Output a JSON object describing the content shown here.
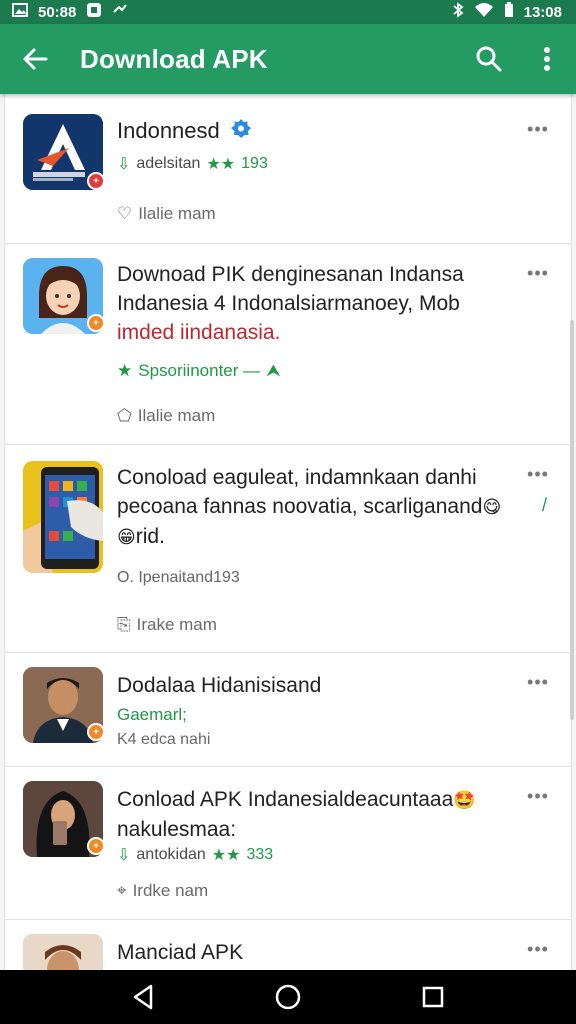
{
  "status_bar": {
    "left_text": "50:88",
    "right_time": "13:08"
  },
  "app_bar": {
    "title": "Download APK"
  },
  "items": [
    {
      "title": "Indonnesd",
      "meta_text": "adelsitan",
      "rating": "193",
      "action": "Ilalie mam"
    },
    {
      "title_line1": "Downoad PIK denginesanan Indansa",
      "title_line2": "Indanesia 4 Indonalsiarmanoey, Mob",
      "title_line3": "imded iindanasia.",
      "meta_text": "Spsoriinonter —",
      "action": "Ilalie mam"
    },
    {
      "title_line1": "Conoload eaguleat, indamnkaan danhi",
      "title_line2": "pecoana fannas noovatia, scarliganand",
      "title_line3": "rid.",
      "meta_text": "O. Ipenaitand193",
      "action": "Irake mam"
    },
    {
      "title": "Dodalaa Hidanisisand",
      "subtitle": "Gaemarl;",
      "meta_text": "K4 edca nahi",
      "action": ""
    },
    {
      "title_line1": "Conload APK Indanesialdeacuntaaa",
      "title_line2": "nakulesmaa:",
      "meta_text": "antokidan",
      "rating": "333",
      "action": "Irdke nam"
    },
    {
      "title": "Manciad APK"
    }
  ],
  "colors": {
    "status": "#1b7a4e",
    "app_bar": "#239b63",
    "accent_green": "#1e9a46",
    "red_text": "#c0262d"
  }
}
